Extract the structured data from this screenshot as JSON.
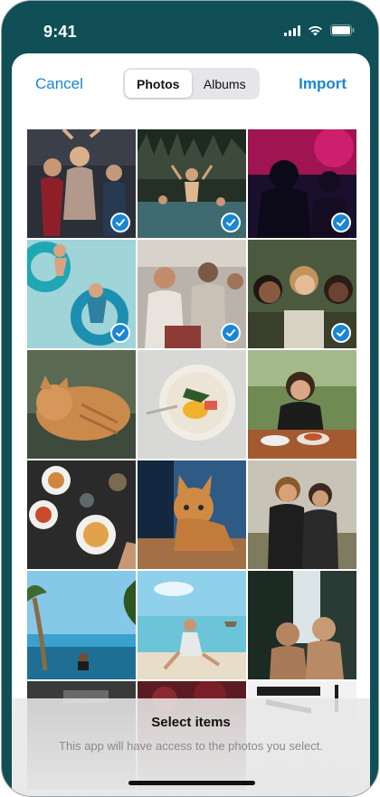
{
  "status_bar": {
    "time": "9:41",
    "icons": [
      "cellular-icon",
      "wifi-icon",
      "battery-icon"
    ]
  },
  "nav": {
    "cancel_label": "Cancel",
    "import_label": "Import",
    "segments": [
      {
        "label": "Photos",
        "active": true
      },
      {
        "label": "Albums",
        "active": false
      }
    ]
  },
  "photos": [
    {
      "name": "party-dancing",
      "selected": true
    },
    {
      "name": "pool-party",
      "selected": true
    },
    {
      "name": "concert-crowd",
      "selected": true
    },
    {
      "name": "pool-floats",
      "selected": true
    },
    {
      "name": "friends-outdoors",
      "selected": true
    },
    {
      "name": "three-friends-selfie",
      "selected": true
    },
    {
      "name": "cat-lying",
      "selected": false
    },
    {
      "name": "food-plate",
      "selected": false
    },
    {
      "name": "woman-dining",
      "selected": false
    },
    {
      "name": "table-top-food",
      "selected": false
    },
    {
      "name": "cat-sitting",
      "selected": false
    },
    {
      "name": "couple-laughing",
      "selected": false
    },
    {
      "name": "beach-tree",
      "selected": false
    },
    {
      "name": "beach-woman",
      "selected": false
    },
    {
      "name": "waterfall-friends",
      "selected": false
    },
    {
      "name": "partial-photo-1",
      "selected": false
    },
    {
      "name": "partial-photo-2",
      "selected": false
    },
    {
      "name": "partial-photo-3",
      "selected": false
    }
  ],
  "footer": {
    "title": "Select items",
    "description": "This app will have access to the photos you select."
  },
  "colors": {
    "accent": "#1a86d6",
    "status_bar_bg": "#0f4f55"
  }
}
